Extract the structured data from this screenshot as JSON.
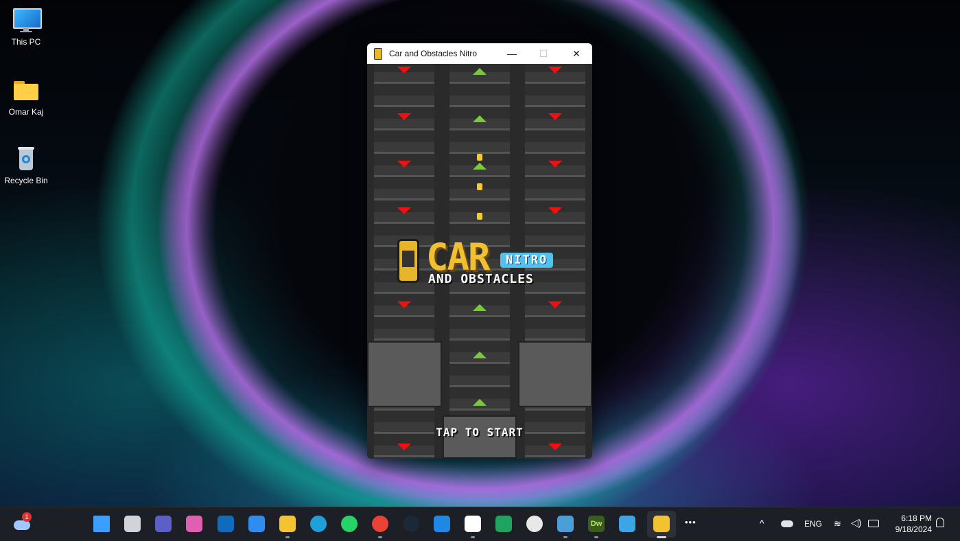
{
  "desktop": {
    "icons": [
      {
        "label": "This PC"
      },
      {
        "label": "Omar Kaj"
      },
      {
        "label": "Recycle Bin"
      }
    ]
  },
  "window": {
    "title": "Car and Obstacles Nitro",
    "controls": {
      "minimize": "—",
      "maximize": "☐",
      "close": "✕"
    }
  },
  "game": {
    "logo_car": "CAR",
    "logo_nitro": "NITRO",
    "logo_obstacles": "AND OBSTACLES",
    "prompt": "TAP TO START"
  },
  "taskbar": {
    "weather_badge": "1",
    "apps": [
      "start-icon",
      "task-view-icon",
      "meet-icon",
      "copilot-icon",
      "outlook-icon",
      "todo-icon",
      "file-explorer-icon",
      "edge-icon",
      "whatsapp-icon",
      "chrome-icon",
      "steam-icon",
      "app-installer-icon",
      "store-icon",
      "media-player-icon",
      "obs-icon",
      "remote-desktop-icon",
      "dreamweaver-icon",
      "notepad-icon",
      "car-game-icon"
    ],
    "dreamweaver_label": "Dw",
    "more": "•••",
    "tray": {
      "chevron": "^",
      "language": "ENG",
      "time": "6:18 PM",
      "date": "9/18/2024"
    }
  }
}
